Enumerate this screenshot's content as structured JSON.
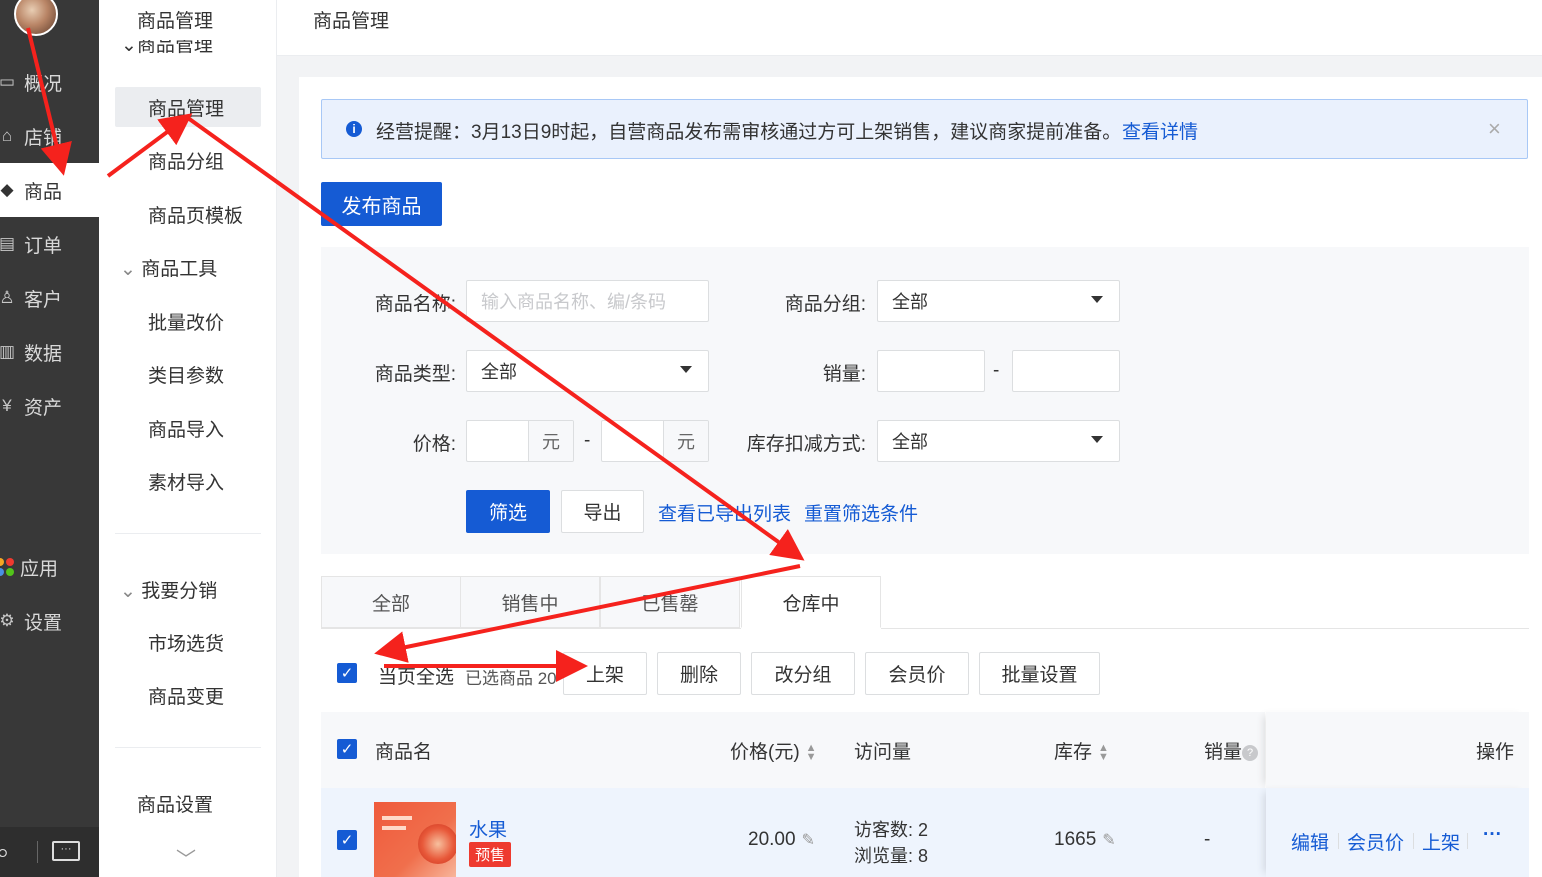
{
  "nav": {
    "items": [
      {
        "label": "概况",
        "icon": "monitor-icon"
      },
      {
        "label": "店铺",
        "icon": "store-icon"
      },
      {
        "label": "商品",
        "icon": "tag-icon"
      },
      {
        "label": "订单",
        "icon": "order-icon"
      },
      {
        "label": "客户",
        "icon": "user-icon"
      },
      {
        "label": "数据",
        "icon": "chart-icon"
      },
      {
        "label": "资产",
        "icon": "yen-icon"
      },
      {
        "label": "应用",
        "icon": "apps-icon"
      },
      {
        "label": "设置",
        "icon": "gear-icon"
      }
    ]
  },
  "subnav": {
    "title": "商品管理",
    "group_partial": "商品管理",
    "items_main": [
      "商品管理",
      "商品分组",
      "商品页模板"
    ],
    "group_tools": "商品工具",
    "items_tools": [
      "批量改价",
      "类目参数",
      "商品导入",
      "素材导入"
    ],
    "group_dist": "我要分销",
    "items_dist": [
      "市场选货",
      "商品变更"
    ],
    "settings": "商品设置"
  },
  "topbar": {
    "title": "商品管理"
  },
  "notice": {
    "text": "经营提醒：3月13日9时起，自营商品发布需审核通过方可上架销售，建议商家提前准备。",
    "link": "查看详情"
  },
  "publish_button": "发布商品",
  "filters": {
    "name_label": "商品名称:",
    "name_placeholder": "输入商品名称、编/条码",
    "group_label": "商品分组:",
    "group_value": "全部",
    "type_label": "商品类型:",
    "type_value": "全部",
    "sales_label": "销量:",
    "range_sep": "-",
    "price_label": "价格:",
    "unit": "元",
    "stock_label": "库存扣减方式:",
    "stock_value": "全部",
    "filter_button": "筛选",
    "export_button": "导出",
    "view_exports": "查看已导出列表",
    "reset": "重置筛选条件"
  },
  "tabs": [
    "全部",
    "销售中",
    "已售罄",
    "仓库中"
  ],
  "bulk": {
    "select_all": "当页全选",
    "selected_count": "已选商品 20",
    "buttons": [
      "上架",
      "删除",
      "改分组",
      "会员价",
      "批量设置"
    ]
  },
  "table": {
    "headers": {
      "name": "商品名",
      "price": "价格(元)",
      "visits": "访问量",
      "stock": "库存",
      "sales": "销量",
      "ops": "操作"
    },
    "rows": [
      {
        "name": "水果",
        "badge": "预售",
        "price": "20.00",
        "visitors": "访客数: 2",
        "views": "浏览量: 8",
        "stock": "1665",
        "sales": "-",
        "ops": [
          "编辑",
          "会员价",
          "上架"
        ],
        "more": "···"
      }
    ]
  },
  "colors": {
    "primary": "#155bd4",
    "arrow": "#f5221d",
    "sidebar": "#383838",
    "badge": "#ee3a2f"
  }
}
